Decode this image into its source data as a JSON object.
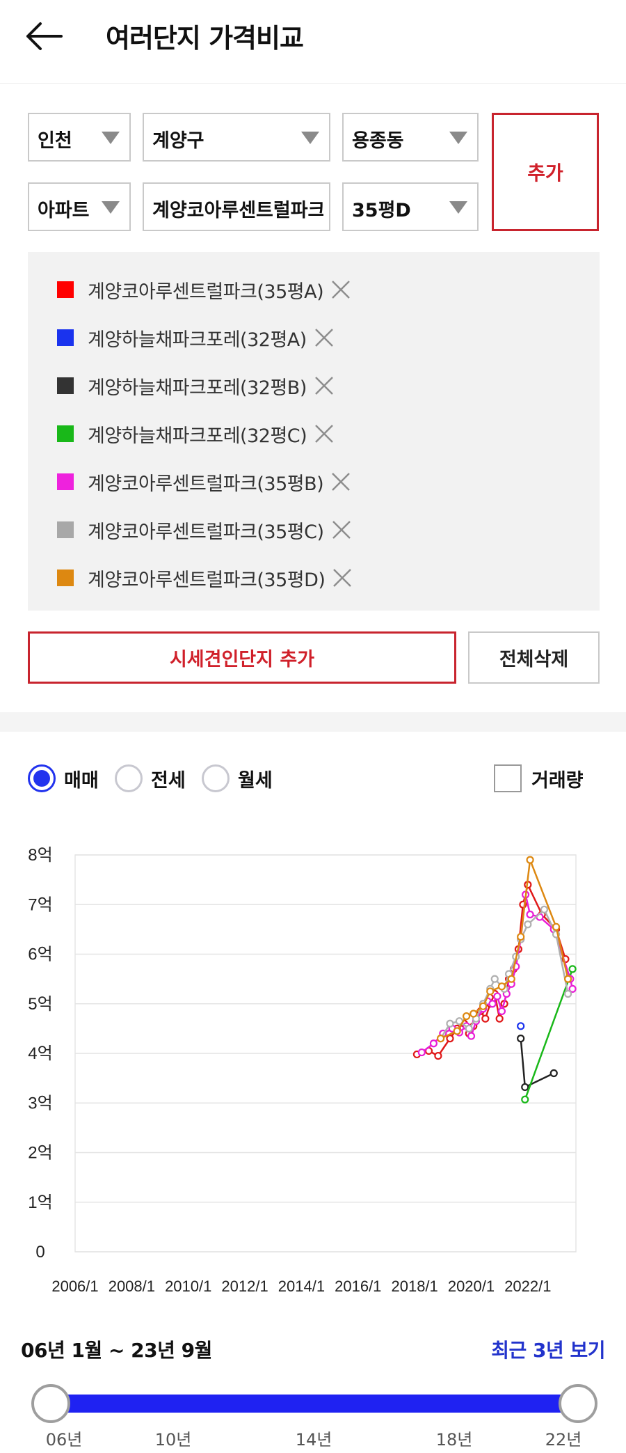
{
  "header": {
    "title": "여러단지 가격비교",
    "back_icon": "back-arrow-icon"
  },
  "filters": {
    "sido": "인천",
    "gu": "계양구",
    "dong": "용종동",
    "type": "아파트",
    "complex": "계양코아루센트럴파크",
    "size": "35평D",
    "add_label": "추가"
  },
  "compare_list": [
    {
      "label": "계양코아루센트럴파크(35평A)",
      "color": "#ff0000"
    },
    {
      "label": "계양하늘채파크포레(32평A)",
      "color": "#1a33ee"
    },
    {
      "label": "계양하늘채파크포레(32평B)",
      "color": "#333333"
    },
    {
      "label": "계양하늘채파크포레(32평C)",
      "color": "#19b819"
    },
    {
      "label": "계양코아루센트럴파크(35평B)",
      "color": "#ee22dd"
    },
    {
      "label": "계양코아루센트럴파크(35평C)",
      "color": "#a8a8a8"
    },
    {
      "label": "계양코아루센트럴파크(35평D)",
      "color": "#dd8811"
    }
  ],
  "actions": {
    "similar_label": "시세견인단지 추가",
    "delete_all_label": "전체삭제"
  },
  "deal_types": {
    "sale": "매매",
    "jeonse": "전세",
    "monthly": "월세",
    "selected": "매매",
    "volume_label": "거래량",
    "volume_checked": false
  },
  "chart_data": {
    "type": "line",
    "y_unit": "억",
    "ylim": [
      0,
      8
    ],
    "y_tick_labels": [
      "0",
      "1억",
      "2억",
      "3억",
      "4억",
      "5억",
      "6억",
      "7억",
      "8억"
    ],
    "x_tick_labels": [
      "2006/1",
      "2008/1",
      "2010/1",
      "2012/1",
      "2014/1",
      "2016/1",
      "2018/1",
      "2020/1",
      "2022/1"
    ],
    "xlim": [
      2006.0,
      2023.7
    ],
    "grid": true,
    "series": [
      {
        "name": "계양코아루센트럴파크(35평A)",
        "color": "#e01818",
        "points": [
          [
            2018.08,
            3.98
          ],
          [
            2018.5,
            4.05
          ],
          [
            2018.83,
            3.95
          ],
          [
            2019.25,
            4.3
          ],
          [
            2019.5,
            4.5
          ],
          [
            2019.75,
            4.6
          ],
          [
            2019.92,
            4.4
          ],
          [
            2020.08,
            4.55
          ],
          [
            2020.33,
            4.85
          ],
          [
            2020.5,
            4.7
          ],
          [
            2020.67,
            5.0
          ],
          [
            2020.83,
            5.2
          ],
          [
            2021.0,
            4.7
          ],
          [
            2021.17,
            5.0
          ],
          [
            2021.33,
            5.5
          ],
          [
            2021.5,
            5.7
          ],
          [
            2021.67,
            6.1
          ],
          [
            2021.83,
            7.0
          ],
          [
            2022.0,
            7.4
          ],
          [
            2022.5,
            6.8
          ],
          [
            2023.0,
            6.5
          ],
          [
            2023.33,
            5.9
          ]
        ]
      },
      {
        "name": "계양하늘채파크포레(32평A)",
        "color": "#1a33ee",
        "points": [
          [
            2021.75,
            4.55
          ]
        ]
      },
      {
        "name": "계양하늘채파크포레(32평B)",
        "color": "#222222",
        "points": [
          [
            2021.75,
            4.3
          ],
          [
            2021.9,
            3.32
          ],
          [
            2022.92,
            3.6
          ]
        ]
      },
      {
        "name": "계양하늘채파크포레(32평C)",
        "color": "#19b819",
        "points": [
          [
            2021.9,
            3.07
          ],
          [
            2023.58,
            5.7
          ]
        ]
      },
      {
        "name": "계양코아루센트럴파크(35평B)",
        "color": "#e81ed6",
        "points": [
          [
            2018.25,
            4.02
          ],
          [
            2018.67,
            4.2
          ],
          [
            2019.0,
            4.4
          ],
          [
            2019.33,
            4.5
          ],
          [
            2019.58,
            4.42
          ],
          [
            2019.83,
            4.55
          ],
          [
            2020.0,
            4.35
          ],
          [
            2020.17,
            4.65
          ],
          [
            2020.42,
            4.9
          ],
          [
            2020.58,
            5.05
          ],
          [
            2020.75,
            5.0
          ],
          [
            2020.92,
            5.15
          ],
          [
            2021.08,
            4.85
          ],
          [
            2021.25,
            5.2
          ],
          [
            2021.42,
            5.4
          ],
          [
            2021.58,
            5.75
          ],
          [
            2021.75,
            6.3
          ],
          [
            2021.92,
            7.2
          ],
          [
            2022.08,
            6.8
          ],
          [
            2022.42,
            6.75
          ],
          [
            2022.92,
            6.5
          ],
          [
            2023.5,
            5.5
          ],
          [
            2023.58,
            5.3
          ]
        ]
      },
      {
        "name": "계양코아루센트럴파크(35평C)",
        "color": "#b0b0b0",
        "points": [
          [
            2018.92,
            4.3
          ],
          [
            2019.25,
            4.6
          ],
          [
            2019.58,
            4.65
          ],
          [
            2019.92,
            4.5
          ],
          [
            2020.17,
            4.7
          ],
          [
            2020.42,
            5.0
          ],
          [
            2020.67,
            5.3
          ],
          [
            2020.83,
            5.5
          ],
          [
            2021.17,
            5.3
          ],
          [
            2021.33,
            5.6
          ],
          [
            2021.58,
            5.95
          ],
          [
            2021.75,
            6.3
          ],
          [
            2022.0,
            6.6
          ],
          [
            2022.58,
            6.9
          ],
          [
            2023.0,
            6.4
          ],
          [
            2023.42,
            5.2
          ]
        ]
      },
      {
        "name": "계양코아루센트럴파크(35평D)",
        "color": "#dd8811",
        "points": [
          [
            2018.92,
            4.3
          ],
          [
            2019.5,
            4.45
          ],
          [
            2019.83,
            4.75
          ],
          [
            2020.08,
            4.8
          ],
          [
            2020.42,
            4.95
          ],
          [
            2020.67,
            5.25
          ],
          [
            2021.08,
            5.35
          ],
          [
            2021.42,
            5.5
          ],
          [
            2021.75,
            6.35
          ],
          [
            2022.08,
            7.9
          ],
          [
            2023.0,
            6.55
          ],
          [
            2023.42,
            5.5
          ]
        ]
      }
    ]
  },
  "period": {
    "text": "06년 1월 ~ 23년 9월",
    "recent_label": "최근 3년 보기",
    "ticks": [
      "06년",
      "10년",
      "14년",
      "18년",
      "22년"
    ],
    "range_start": 0.0,
    "range_end": 1.0
  }
}
